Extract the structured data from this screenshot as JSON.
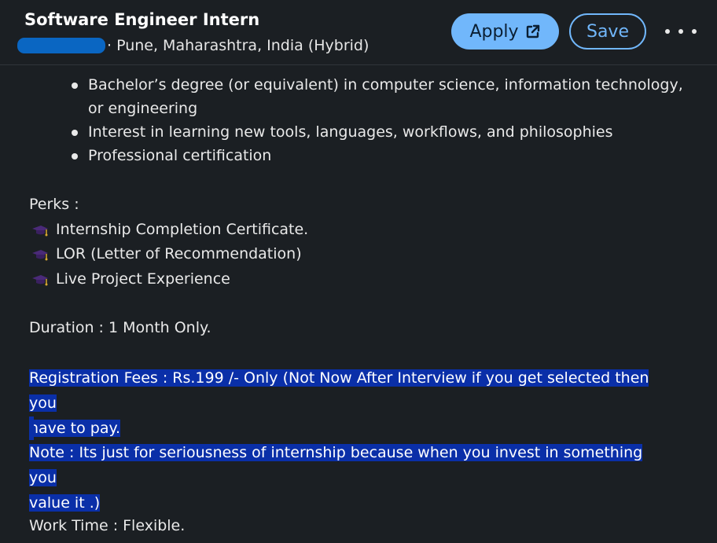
{
  "header": {
    "title": "Software Engineer Intern",
    "location": "· Pune, Maharashtra, India (Hybrid)",
    "apply_label": "Apply",
    "save_label": "Save"
  },
  "requirements": [
    "Bachelor’s degree (or equivalent) in computer science, information technology, or engineering",
    "Interest in learning new tools, languages, workflows, and philosophies",
    "Professional certification"
  ],
  "perks": {
    "heading": "Perks :",
    "items": [
      "Internship Completion Certificate.",
      "LOR (Letter of Recommendation)",
      "Live Project Experience"
    ]
  },
  "duration": "Duration : 1 Month Only.",
  "registration_line1": "Registration Fees : Rs.199 /- Only (Not Now After Interview if you get selected then you",
  "registration_line2": "have to pay.",
  "note_line1": "Note : Its just for seriousness of internship because when you invest in something you",
  "note_line2": "value it .)",
  "work_time": "Work Time : Flexible.",
  "colors": {
    "background": "#1b1f23",
    "accent": "#71b7fb",
    "selection": "#0a2fa8",
    "redaction": "#0a66c2"
  }
}
